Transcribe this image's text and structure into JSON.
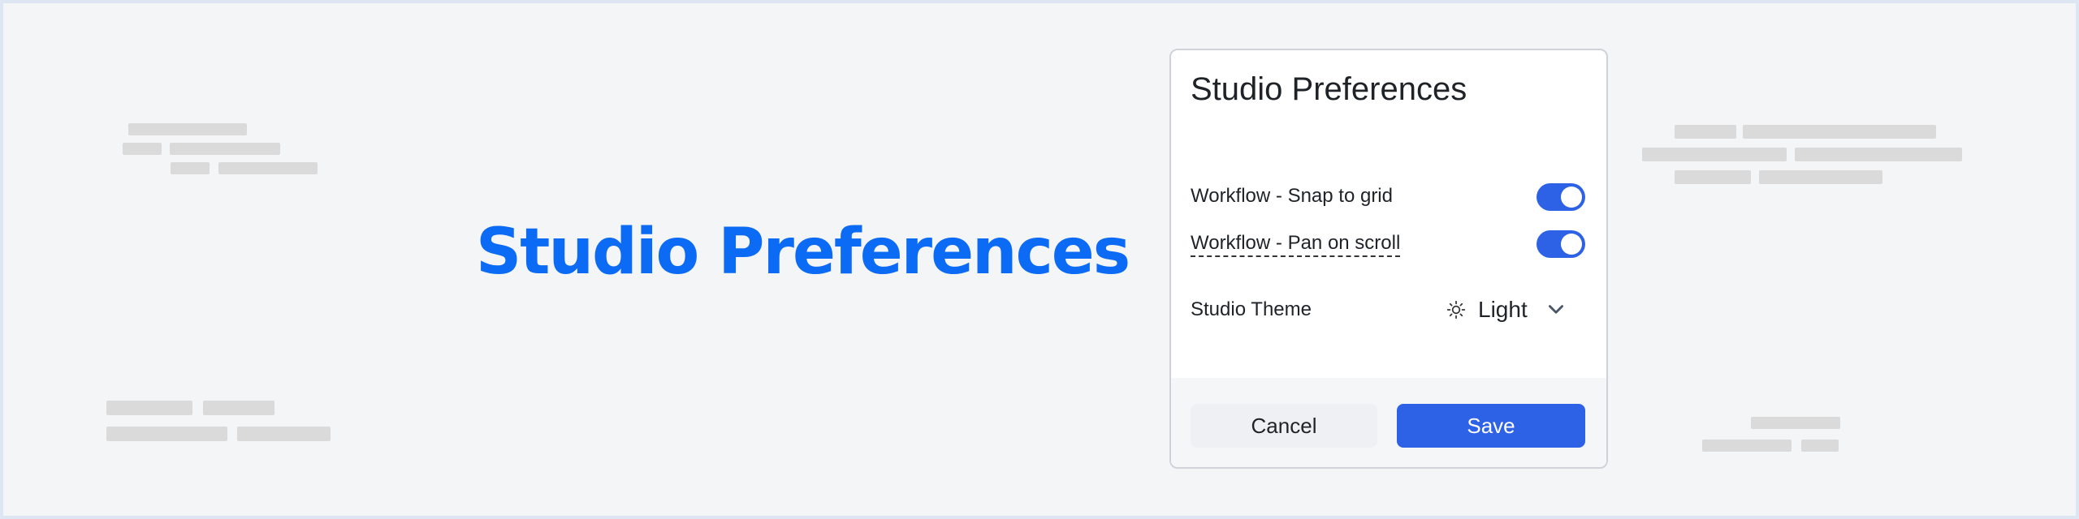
{
  "hero": {
    "title": "Studio Preferences"
  },
  "dialog": {
    "title": "Studio Preferences",
    "settings": [
      {
        "label": "Workflow - Snap to grid",
        "enabled": true
      },
      {
        "label": "Workflow - Pan on scroll",
        "enabled": true
      }
    ],
    "theme": {
      "label": "Studio Theme",
      "value": "Light",
      "icon": "sun-icon"
    },
    "buttons": {
      "cancel": "Cancel",
      "save": "Save"
    }
  },
  "colors": {
    "accent": "#2e62e6",
    "hero_text": "#0b6bf5",
    "background": "#f4f5f7",
    "placeholder": "#dadada"
  }
}
